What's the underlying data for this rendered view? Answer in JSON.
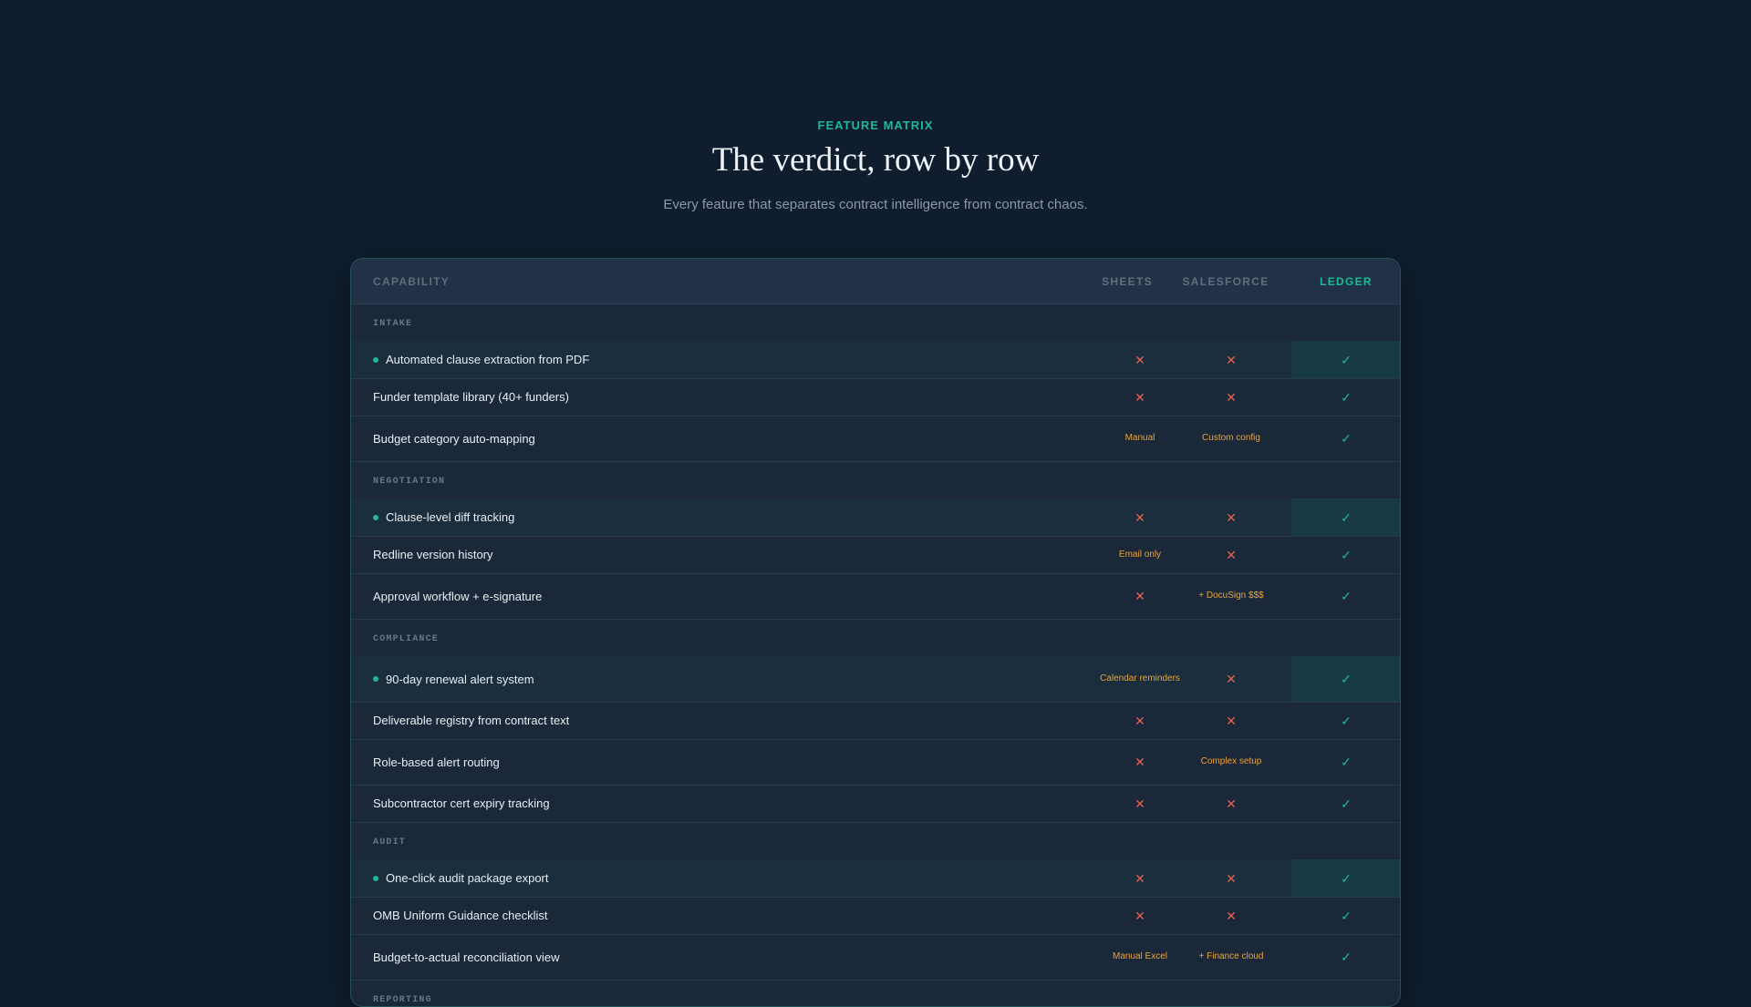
{
  "header": {
    "eyebrow": "FEATURE MATRIX",
    "title": "The verdict, row by row",
    "subtitle": "Every feature that separates contract intelligence from contract chaos."
  },
  "table": {
    "columns": {
      "capability": "CAPABILITY",
      "sheets": "SHEETS",
      "salesforce": "SALESFORCE",
      "ledger": "LEDGER"
    },
    "sections": [
      {
        "label": "INTAKE",
        "rows": [
          {
            "name": "Automated clause extraction from PDF",
            "highlight": true,
            "sheets": "✕",
            "salesforce": "✕",
            "ledger": "✓"
          },
          {
            "name": "Funder template library (40+ funders)",
            "highlight": false,
            "sheets": "✕",
            "salesforce": "✕",
            "ledger": "✓"
          },
          {
            "name": "Budget category auto-mapping",
            "highlight": false,
            "sheets": "Manual",
            "salesforce": "Custom config",
            "ledger": "✓"
          }
        ]
      },
      {
        "label": "NEGOTIATION",
        "rows": [
          {
            "name": "Clause-level diff tracking",
            "highlight": true,
            "sheets": "✕",
            "salesforce": "✕",
            "ledger": "✓"
          },
          {
            "name": "Redline version history",
            "highlight": false,
            "sheets": "Email only",
            "salesforce": "✕",
            "ledger": "✓"
          },
          {
            "name": "Approval workflow + e-signature",
            "highlight": false,
            "sheets": "✕",
            "salesforce": "+ DocuSign $$$",
            "ledger": "✓"
          }
        ]
      },
      {
        "label": "COMPLIANCE",
        "rows": [
          {
            "name": "90-day renewal alert system",
            "highlight": true,
            "sheets": "Calendar reminders",
            "salesforce": "✕",
            "ledger": "✓"
          },
          {
            "name": "Deliverable registry from contract text",
            "highlight": false,
            "sheets": "✕",
            "salesforce": "✕",
            "ledger": "✓"
          },
          {
            "name": "Role-based alert routing",
            "highlight": false,
            "sheets": "✕",
            "salesforce": "Complex setup",
            "ledger": "✓"
          },
          {
            "name": "Subcontractor cert expiry tracking",
            "highlight": false,
            "sheets": "✕",
            "salesforce": "✕",
            "ledger": "✓"
          }
        ]
      },
      {
        "label": "AUDIT",
        "rows": [
          {
            "name": "One-click audit package export",
            "highlight": true,
            "sheets": "✕",
            "salesforce": "✕",
            "ledger": "✓"
          },
          {
            "name": "OMB Uniform Guidance checklist",
            "highlight": false,
            "sheets": "✕",
            "salesforce": "✕",
            "ledger": "✓"
          },
          {
            "name": "Budget-to-actual reconciliation view",
            "highlight": false,
            "sheets": "Manual Excel",
            "salesforce": "+ Finance cloud",
            "ledger": "✓"
          }
        ]
      },
      {
        "label": "REPORTING",
        "rows": []
      }
    ]
  },
  "colors": {
    "accent": "#1fb89a",
    "negative": "#e4614f",
    "partial": "#e8a43a",
    "background": "#0f1d2e"
  }
}
